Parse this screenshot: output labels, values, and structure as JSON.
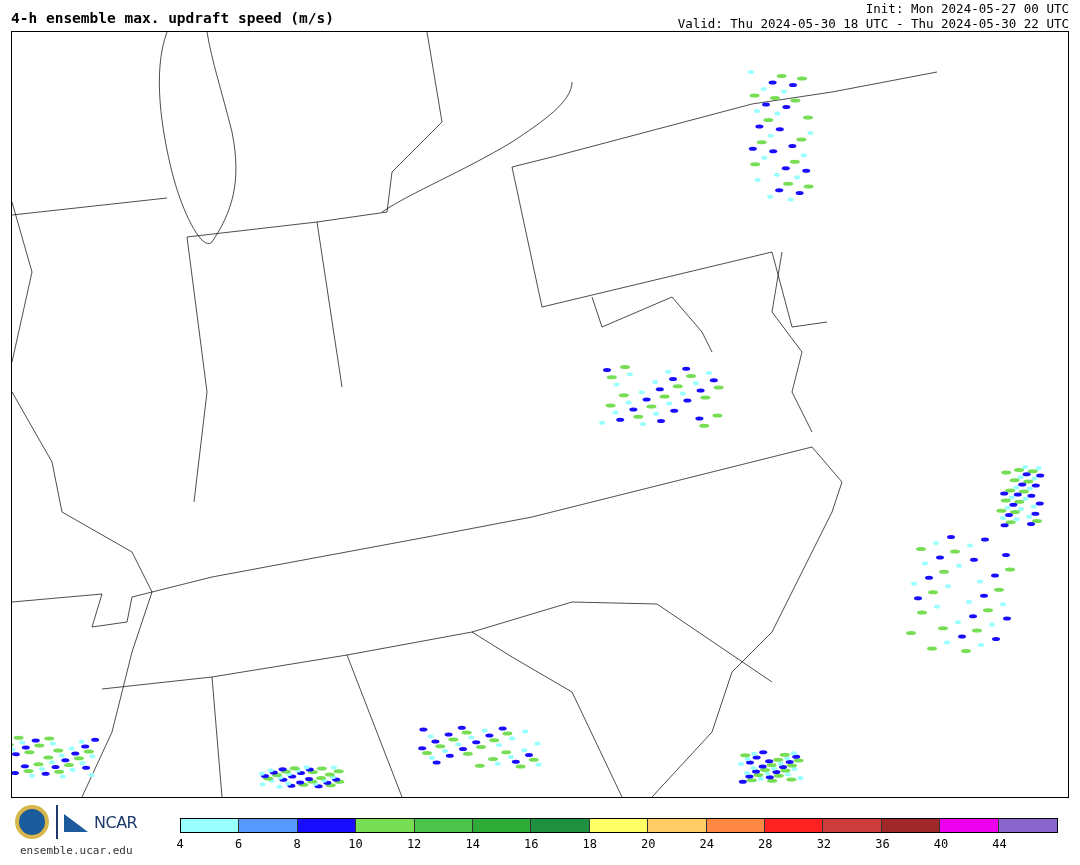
{
  "title": "4-h ensemble max. updraft speed (m/s)",
  "init": "Init: Mon 2024-05-27 00 UTC",
  "valid": "Valid: Thu 2024-05-30 18 UTC - Thu 2024-05-30 22 UTC",
  "logo_text": "NCAR",
  "site": "ensemble.ucar.edu",
  "colorbar": [
    {
      "label": "4",
      "color": "#99ffff"
    },
    {
      "label": "6",
      "color": "#5599ff"
    },
    {
      "label": "8",
      "color": "#1a0dff"
    },
    {
      "label": "10",
      "color": "#77dd55"
    },
    {
      "label": "12",
      "color": "#4cc44c"
    },
    {
      "label": "14",
      "color": "#2eaa36"
    },
    {
      "label": "16",
      "color": "#1f9040"
    },
    {
      "label": "18",
      "color": "#ffff66"
    },
    {
      "label": "20",
      "color": "#ffcc66"
    },
    {
      "label": "24",
      "color": "#ff8844"
    },
    {
      "label": "28",
      "color": "#ff2222"
    },
    {
      "label": "32",
      "color": "#cc3c3c"
    },
    {
      "label": "36",
      "color": "#a02828"
    },
    {
      "label": "40",
      "color": "#ee00ee"
    },
    {
      "label": "44",
      "color": "#8866cc"
    }
  ]
}
